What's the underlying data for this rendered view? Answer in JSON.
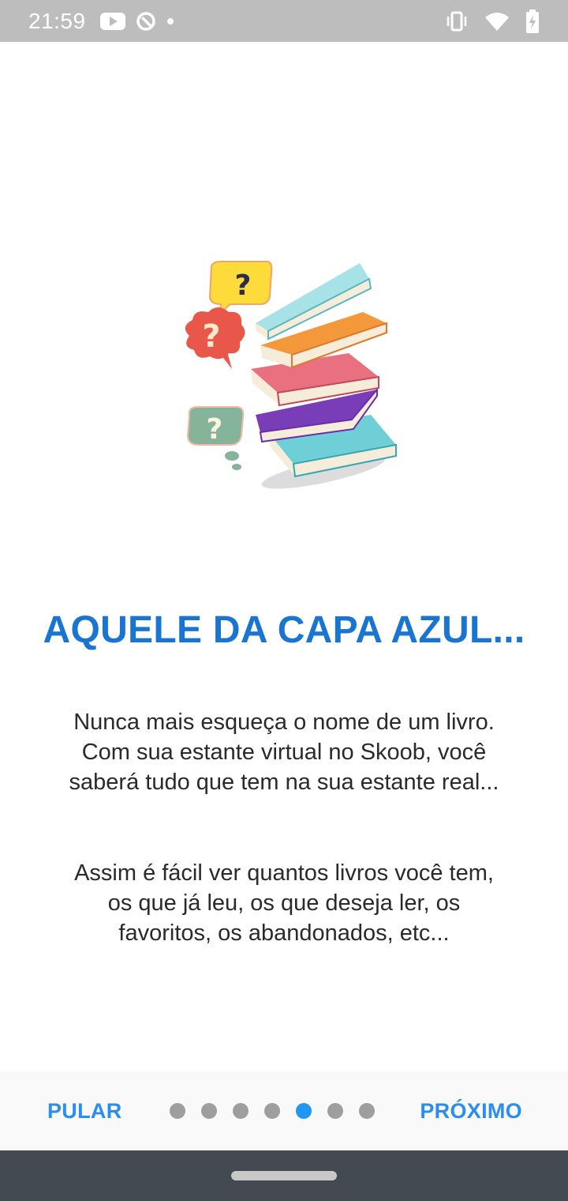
{
  "status_bar": {
    "time": "21:59",
    "left_icons": [
      "youtube-icon",
      "sync-icon",
      "dot-icon"
    ],
    "right_icons": [
      "vibrate-icon",
      "wifi-icon",
      "battery-charging-icon"
    ]
  },
  "onboarding": {
    "title": "AQUELE DA CAPA AZUL...",
    "paragraph_1": "Nunca mais esqueça o nome de um livro. Com sua estante virtual no Skoob, você saberá tudo que tem na sua estante real...",
    "paragraph_2": "Assim é fácil ver quantos livros você tem, os que já leu, os que deseja ler, os favoritos, os abandonados, etc..."
  },
  "bottom_nav": {
    "skip_label": "PULAR",
    "next_label": "PRÓXIMO",
    "page_count": 7,
    "current_page": 5
  },
  "colors": {
    "accent": "#1a75d2",
    "button": "#2a8df0",
    "dot_active": "#2196f3",
    "dot_inactive": "#9e9e9e",
    "status_bar": "#bdbdbd",
    "system_nav": "#444a52"
  }
}
